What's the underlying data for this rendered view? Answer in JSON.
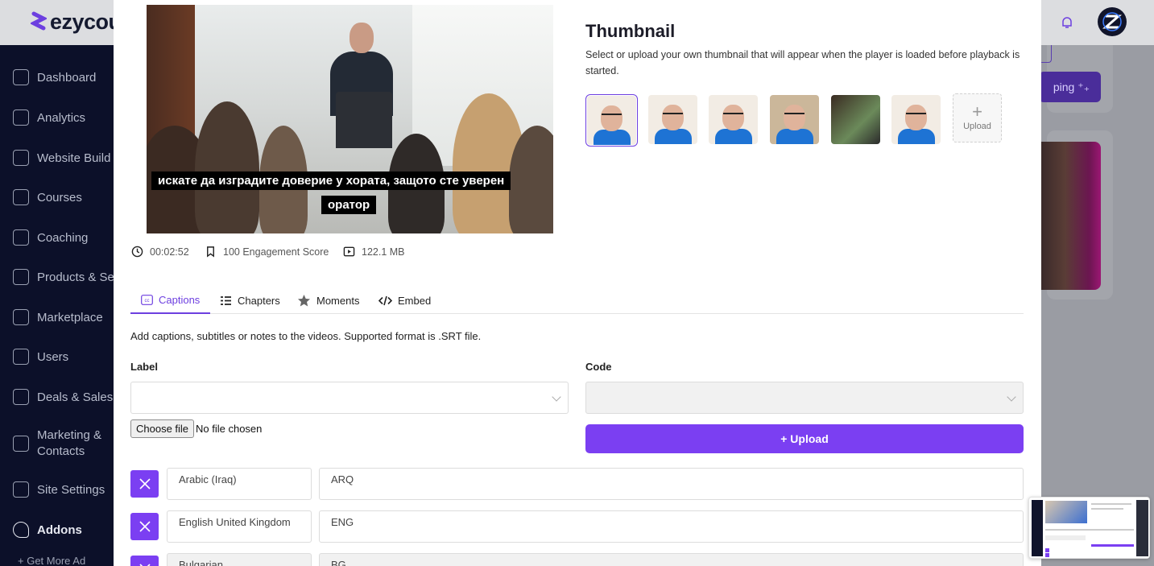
{
  "app": {
    "logo_text": "ezycou"
  },
  "sidebar": {
    "items": [
      {
        "label": "Dashboard",
        "icon": "dashboard-icon"
      },
      {
        "label": "Analytics",
        "icon": "analytics-icon"
      },
      {
        "label": "Website Build",
        "icon": "website-icon"
      },
      {
        "label": "Courses",
        "icon": "courses-icon"
      },
      {
        "label": "Coaching",
        "icon": "coaching-icon"
      },
      {
        "label": "Products & Se",
        "icon": "products-icon"
      },
      {
        "label": "Marketplace",
        "icon": "marketplace-icon"
      },
      {
        "label": "Users",
        "icon": "users-icon"
      },
      {
        "label": "Deals & Sales",
        "icon": "deals-icon"
      },
      {
        "label": "Marketing & Contacts",
        "icon": "marketing-icon"
      },
      {
        "label": "Site Settings",
        "icon": "settings-icon"
      },
      {
        "label": "Addons",
        "icon": "rocket-icon"
      }
    ],
    "sub_item": "+ Get More Ad"
  },
  "background": {
    "button_label": "ping ⁺₊"
  },
  "modal": {
    "video": {
      "caption_line1": "искате да изградите доверие у хората, защото сте уверен",
      "caption_line2": "оратор"
    },
    "meta": {
      "duration": "00:02:52",
      "engagement": "100 Engagement Score",
      "size": "122.1 MB"
    },
    "thumbnail": {
      "title": "Thumbnail",
      "description": "Select or upload your own thumbnail that will appear when the player is loaded before playback is started.",
      "upload_label": "Upload"
    },
    "tabs": [
      {
        "label": "Captions",
        "icon": "cc-icon"
      },
      {
        "label": "Chapters",
        "icon": "list-icon"
      },
      {
        "label": "Moments",
        "icon": "star-icon"
      },
      {
        "label": "Embed",
        "icon": "code-icon"
      }
    ],
    "captions": {
      "description": "Add captions, subtitles or notes to the videos. Supported format is .SRT file.",
      "label_field": "Label",
      "code_field": "Code",
      "choose_file": "Choose file",
      "no_file": "No file chosen",
      "upload_button": "+ Upload",
      "rows": [
        {
          "label": "Arabic (Iraq)",
          "code": "ARQ"
        },
        {
          "label": "English United Kingdom",
          "code": "ENG"
        },
        {
          "label": "Bulgarian",
          "code": "BG"
        }
      ]
    }
  },
  "colors": {
    "accent": "#7b3ff2",
    "sidebar_bg": "#0c1029"
  }
}
